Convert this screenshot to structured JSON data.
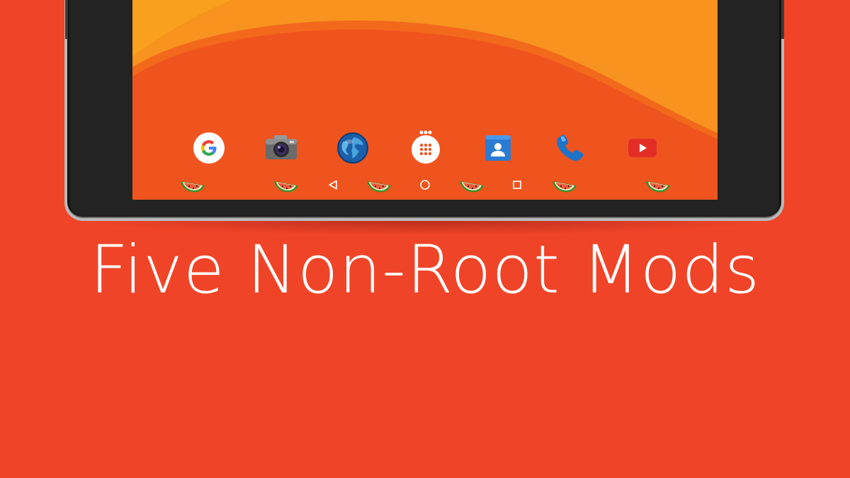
{
  "headline": "Five Non-Root Mods",
  "colors": {
    "background": "#f04428",
    "wallpaper_dark": "#f0541e",
    "wallpaper_light": "#f7931e",
    "device_bezel": "#232323",
    "device_rim": "#b9b9b9"
  },
  "dock": {
    "apps": [
      {
        "name": "Google",
        "icon": "google-icon"
      },
      {
        "name": "Camera",
        "icon": "camera-icon"
      },
      {
        "name": "Browser",
        "icon": "globe-icon"
      },
      {
        "name": "Apps",
        "icon": "app-drawer-icon"
      },
      {
        "name": "Contacts",
        "icon": "contacts-icon"
      },
      {
        "name": "Phone",
        "icon": "phone-icon"
      },
      {
        "name": "YouTube",
        "icon": "youtube-icon"
      }
    ]
  },
  "navbar": {
    "buttons": [
      {
        "name": "Back",
        "icon": "back-triangle-icon"
      },
      {
        "name": "Home",
        "icon": "home-circle-icon"
      },
      {
        "name": "Recents",
        "icon": "recents-square-icon"
      }
    ],
    "decoration": "watermelon-icon"
  }
}
